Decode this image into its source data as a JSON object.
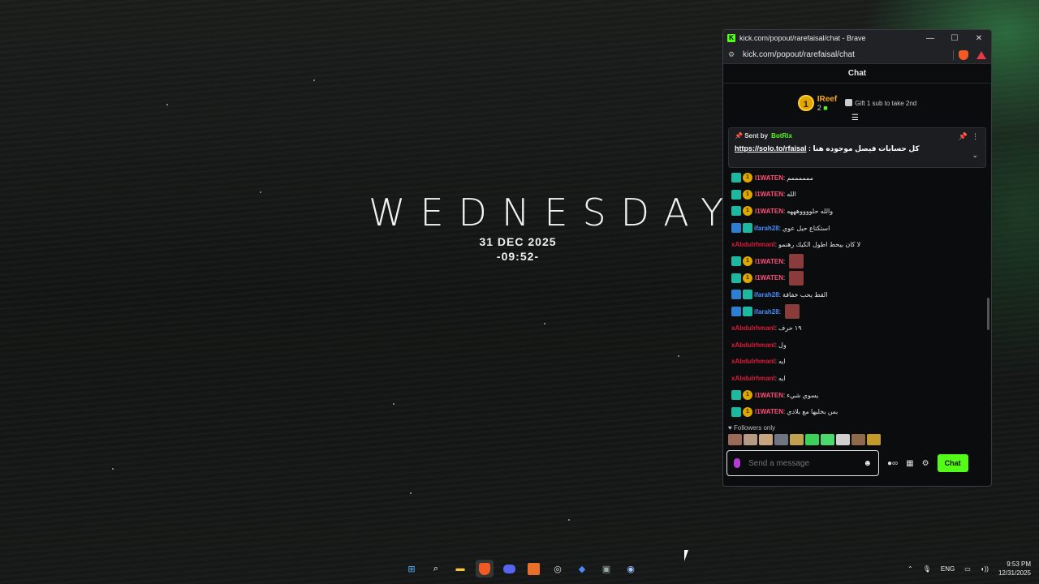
{
  "desktop": {
    "day": "WEDNESDAY",
    "date": "31 DEC 2025",
    "time": "-09:52-"
  },
  "browser": {
    "title": "kick.com/popout/rarefaisal/chat - Brave",
    "url": "kick.com/popout/rarefaisal/chat",
    "controls": {
      "minimize": "—",
      "maximize": "☐",
      "close": "✕"
    }
  },
  "chat": {
    "header": "Chat",
    "leaderboard": {
      "rank": "1",
      "name": "IReef",
      "count": "2",
      "gift_text": "Gift 1 sub to take 2nd"
    },
    "pinned": {
      "sent_by_label": "Sent by",
      "bot_name": "BotRix",
      "message": "كل حسابات فيصل موجوده هنا :",
      "link": "https://solo.to/rfaisal"
    },
    "messages": [
      {
        "user": "I1WATEN",
        "color": "pink",
        "badges": [
          "sub",
          "1"
        ],
        "text": "ممممممم",
        "emote": false
      },
      {
        "user": "I1WATEN",
        "color": "pink",
        "badges": [
          "sub",
          "1"
        ],
        "text": "الله",
        "emote": false
      },
      {
        "user": "I1WATEN",
        "color": "pink",
        "badges": [
          "sub",
          "1"
        ],
        "text": "والله حلووووهههه",
        "emote": false
      },
      {
        "user": "ifarah28",
        "color": "blue",
        "badges": [
          "gift",
          "sub"
        ],
        "text": "استكتاع حيل عوي",
        "emote": false
      },
      {
        "user": "xAbdulrhmanl",
        "color": "red",
        "badges": [],
        "text": "لا كان بيحط اطول الكيك رهنمو",
        "emote": false
      },
      {
        "user": "I1WATEN",
        "color": "pink",
        "badges": [
          "sub",
          "1"
        ],
        "text": "",
        "emote": true
      },
      {
        "user": "I1WATEN",
        "color": "pink",
        "badges": [
          "sub",
          "1"
        ],
        "text": "",
        "emote": true
      },
      {
        "user": "ifarah28",
        "color": "blue",
        "badges": [
          "gift",
          "sub"
        ],
        "text": "القط يحب خفافة",
        "emote": false
      },
      {
        "user": "ifarah28",
        "color": "blue",
        "badges": [
          "gift",
          "sub"
        ],
        "text": "",
        "emote": true
      },
      {
        "user": "xAbdulrhmanl",
        "color": "red",
        "badges": [],
        "text": "١٩ حرف",
        "emote": false
      },
      {
        "user": "xAbdulrhmanl",
        "color": "red",
        "badges": [],
        "text": "ول",
        "emote": false
      },
      {
        "user": "xAbdulrhmanl",
        "color": "red",
        "badges": [],
        "text": "ايه",
        "emote": false
      },
      {
        "user": "xAbdulrhmanl",
        "color": "red",
        "badges": [],
        "text": "ايه",
        "emote": false
      },
      {
        "user": "I1WATEN",
        "color": "pink",
        "badges": [
          "sub",
          "1"
        ],
        "text": "يسوي شيء",
        "emote": false
      },
      {
        "user": "I1WATEN",
        "color": "pink",
        "badges": [
          "sub",
          "1"
        ],
        "text": "بس بخليها مع بلادي",
        "emote": false
      }
    ],
    "followers_only": "Followers only",
    "input_placeholder": "Send a message",
    "send_button": "Chat"
  },
  "taskbar": {
    "apps": [
      "windows-start",
      "search",
      "file-explorer",
      "brave",
      "discord",
      "app-orange",
      "obs",
      "app-blue",
      "xbox",
      "steam"
    ],
    "tray": {
      "language": "ENG",
      "time": "9:53 PM",
      "date": "12/31/2025"
    }
  }
}
